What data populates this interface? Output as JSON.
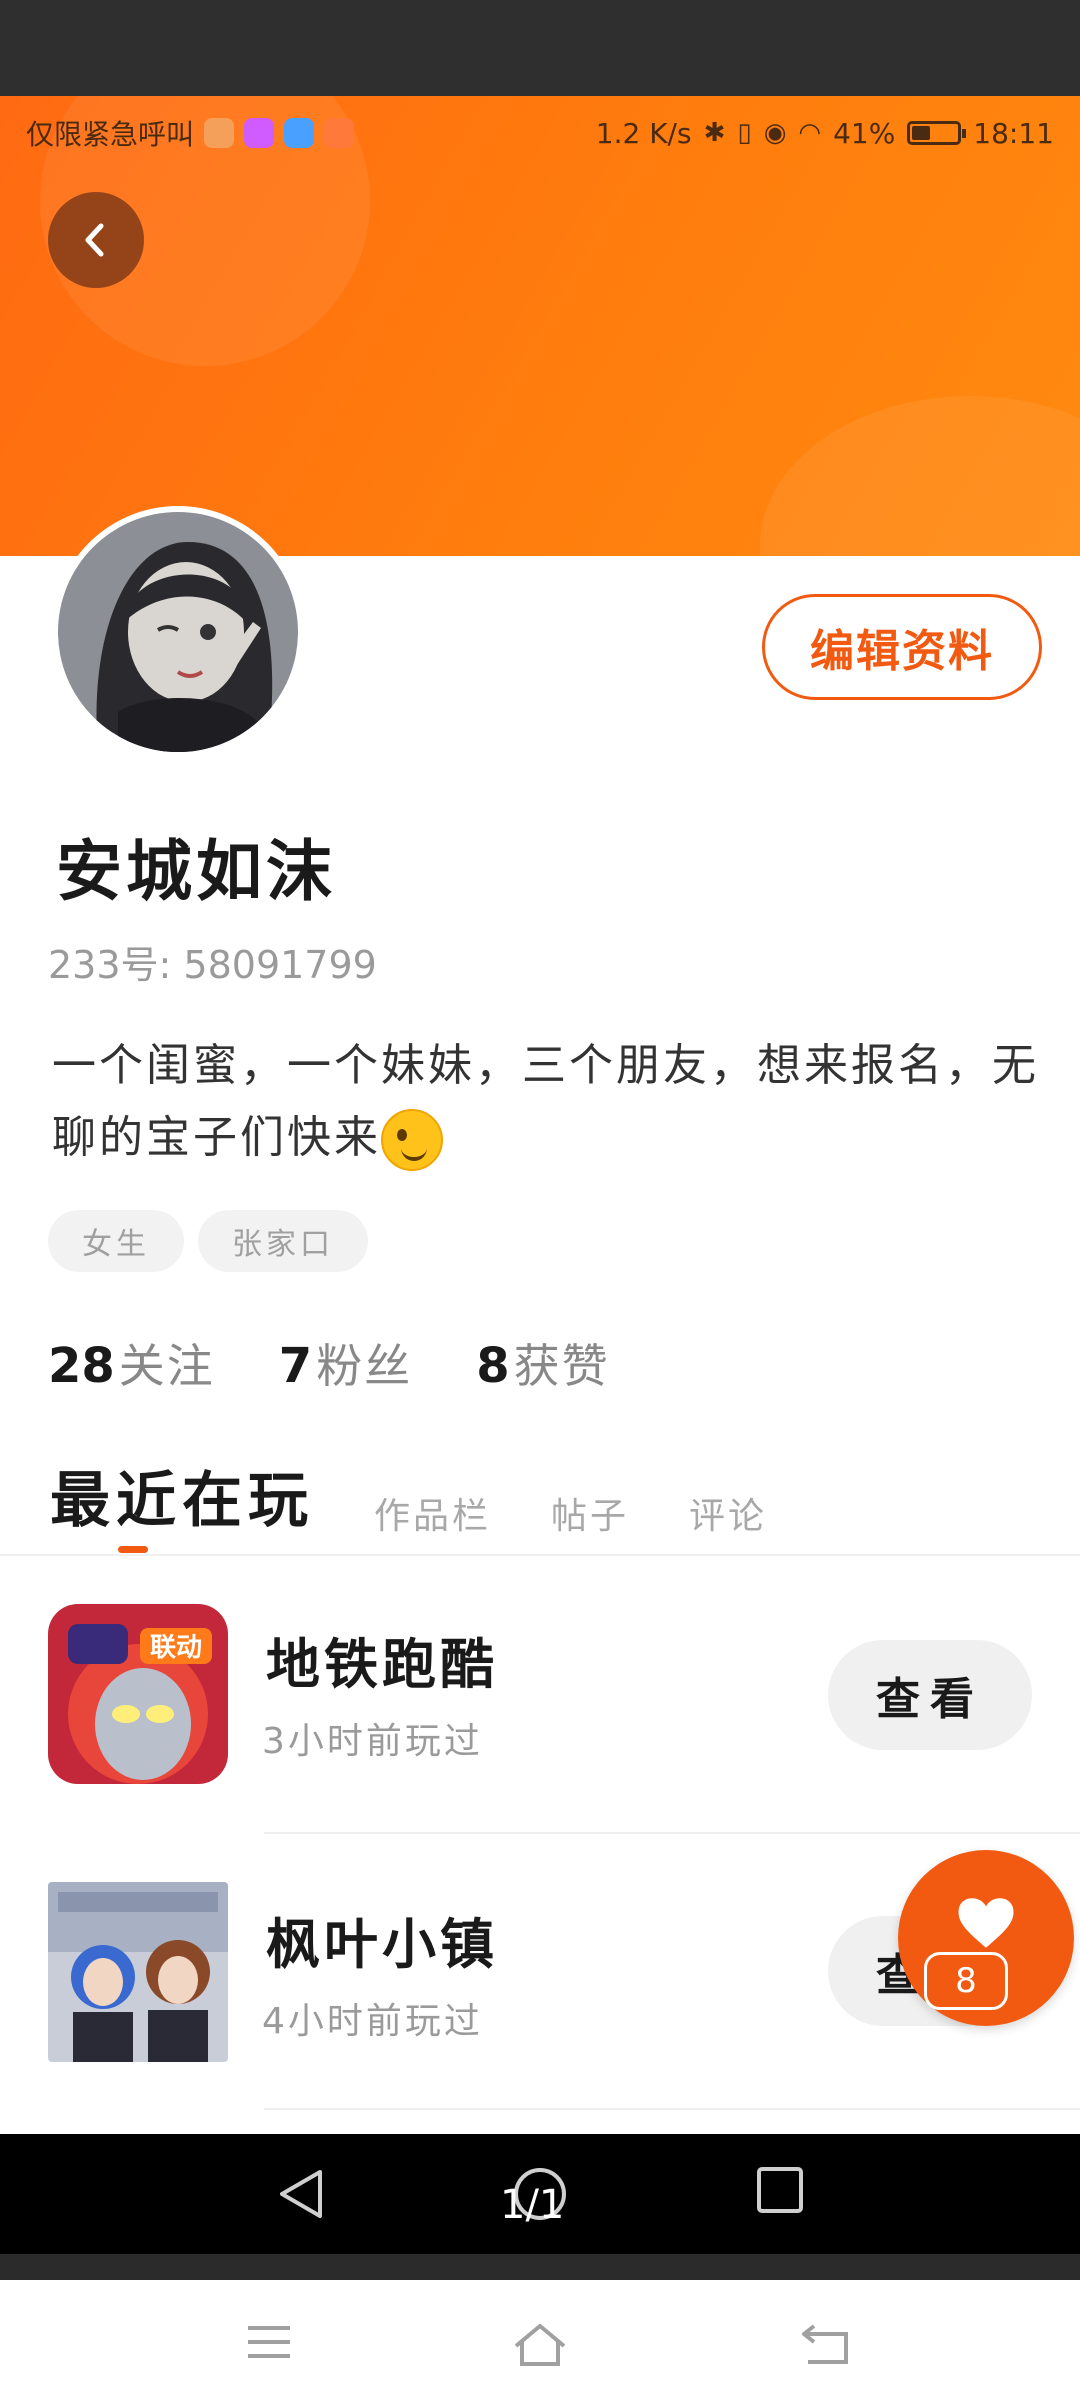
{
  "status_bar": {
    "carrier": "仅限紧急呼叫",
    "speed": "1.2 K/s",
    "battery_percent": "41%",
    "battery_level": 0.41,
    "time": "18:11",
    "app_colors": [
      "#f5a05a",
      "#d05cff",
      "#49a0ff",
      "#ff7a3a"
    ]
  },
  "header": {
    "back_icon": "chevron-left-icon",
    "gradient_start": "#ff6a12",
    "gradient_end": "#ff8a10"
  },
  "profile": {
    "edit_label": "编辑资料",
    "name": "安城如沫",
    "uid": "233号: 58091799",
    "bio": "一个闺蜜，一个妹妹，三个朋友，想来报名，无聊的宝子们快来",
    "tags": [
      "女生",
      "张家口"
    ],
    "stats": [
      {
        "num": "28",
        "label": "关注"
      },
      {
        "num": "7",
        "label": "粉丝"
      },
      {
        "num": "8",
        "label": "获赞"
      }
    ]
  },
  "tabs": [
    "最近在玩",
    "作品栏",
    "帖子",
    "评论"
  ],
  "games": [
    {
      "name": "地铁跑酷",
      "time": "3小时前玩过",
      "button": "查看",
      "badge": "联动"
    },
    {
      "name": "枫叶小镇",
      "time": "4小时前玩过",
      "button": "查看"
    }
  ],
  "like": {
    "count": "8"
  },
  "viewer": {
    "page_indicator": "1/1"
  },
  "colors": {
    "accent": "#f25a12"
  }
}
